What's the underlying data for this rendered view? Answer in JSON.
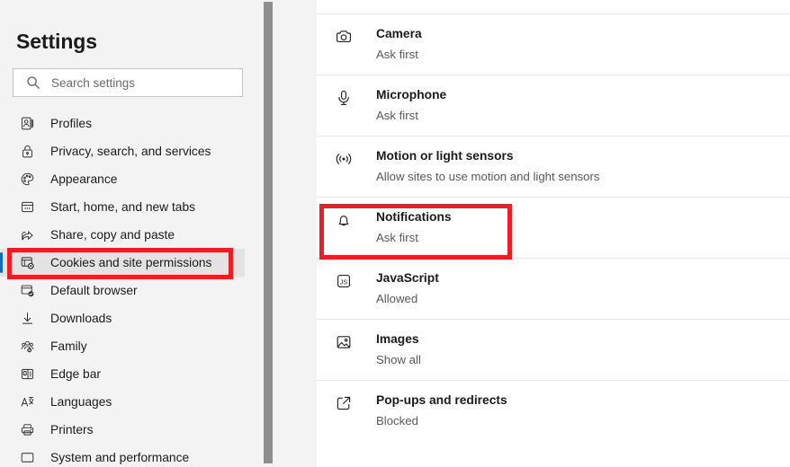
{
  "app": {
    "title": "Settings"
  },
  "search": {
    "placeholder": "Search settings",
    "value": "",
    "icon": "search-icon"
  },
  "colors": {
    "annotation_red": "#ee1c25",
    "selected_accent": "#0f6cbd",
    "selected_bg": "#e3e3e3",
    "sidebar_bg": "#f3f3f3",
    "content_bg": "#ffffff",
    "scrollbar_thumb": "#8e8e8e"
  },
  "sidebar": {
    "items": [
      {
        "label": "Profiles",
        "icon": "profile-icon",
        "selected": false
      },
      {
        "label": "Privacy, search, and services",
        "icon": "lock-icon",
        "selected": false
      },
      {
        "label": "Appearance",
        "icon": "palette-icon",
        "selected": false
      },
      {
        "label": "Start, home, and new tabs",
        "icon": "window-dots-icon",
        "selected": false
      },
      {
        "label": "Share, copy and paste",
        "icon": "share-icon",
        "selected": false
      },
      {
        "label": "Cookies and site permissions",
        "icon": "cookies-permissions-icon",
        "selected": true
      },
      {
        "label": "Default browser",
        "icon": "default-browser-icon",
        "selected": false
      },
      {
        "label": "Downloads",
        "icon": "download-icon",
        "selected": false
      },
      {
        "label": "Family",
        "icon": "family-icon",
        "selected": false
      },
      {
        "label": "Edge bar",
        "icon": "edge-bar-icon",
        "selected": false
      },
      {
        "label": "Languages",
        "icon": "languages-icon",
        "selected": false
      },
      {
        "label": "Printers",
        "icon": "printer-icon",
        "selected": false
      },
      {
        "label": "System and performance",
        "icon": "system-performance-icon",
        "selected": false
      }
    ]
  },
  "content": {
    "permissions": [
      {
        "title": "Camera",
        "status": "Ask first",
        "icon": "camera-icon",
        "highlighted": false
      },
      {
        "title": "Microphone",
        "status": "Ask first",
        "icon": "microphone-icon",
        "highlighted": false
      },
      {
        "title": "Motion or light sensors",
        "status": "Allow sites to use motion and light sensors",
        "icon": "motion-sensor-icon",
        "highlighted": false
      },
      {
        "title": "Notifications",
        "status": "Ask first",
        "icon": "bell-icon",
        "highlighted": true
      },
      {
        "title": "JavaScript",
        "status": "Allowed",
        "icon": "javascript-icon",
        "highlighted": false
      },
      {
        "title": "Images",
        "status": "Show all",
        "icon": "image-icon",
        "highlighted": false
      },
      {
        "title": "Pop-ups and redirects",
        "status": "Blocked",
        "icon": "popup-redirect-icon",
        "highlighted": false
      }
    ]
  },
  "annotations": [
    {
      "name": "redbox-sidebar",
      "target": "Cookies and site permissions"
    },
    {
      "name": "redbox-notifications",
      "target": "Notifications"
    }
  ]
}
